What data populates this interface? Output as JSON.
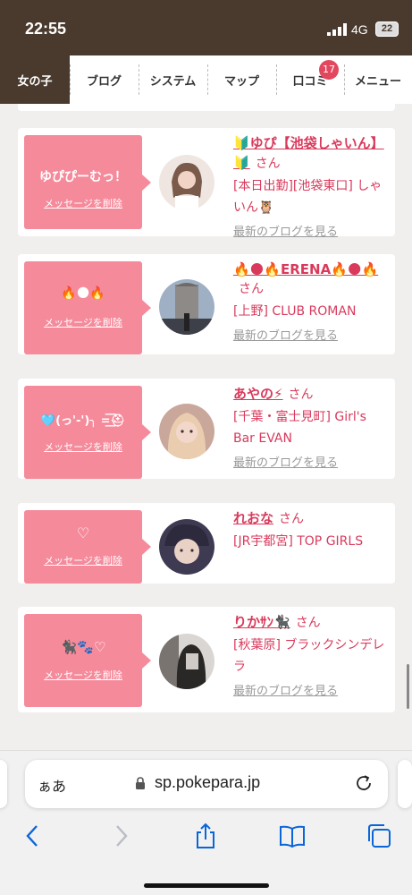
{
  "status": {
    "time": "22:55",
    "network": "4G",
    "battery": "22"
  },
  "nav": {
    "tabs": [
      {
        "label": "女の子",
        "active": true
      },
      {
        "label": "ブログ"
      },
      {
        "label": "システム"
      },
      {
        "label": "マップ"
      },
      {
        "label": "口コミ",
        "badge": "17"
      },
      {
        "label": "メニュー"
      }
    ]
  },
  "messages": [
    {
      "message": "ゆぴぴーむっ！",
      "delete_label": "メッセージを削除",
      "name": "🔰ゆぴ【池袋しゃいん】🔰",
      "san": "さん",
      "shop": "[本日出勤][池袋東口] しゃいん🦉",
      "blog_link": "最新のブログを見る"
    },
    {
      "message": "🔥🌑🔥",
      "delete_label": "メッセージを削除",
      "name": "🔥🌑🔥ERENA🔥🌑🔥",
      "san": "さん",
      "shop": "[上野] CLUB ROMAN",
      "blog_link": "最新のブログを見る"
    },
    {
      "message": "🩵(っ'-')╮ =͟͟͞͞⛑",
      "delete_label": "メッセージを削除",
      "name": "あやの⚡",
      "san": "さん",
      "shop": "[千葉・富士見町] Girl's Bar EVAN",
      "blog_link": "最新のブログを見る"
    },
    {
      "message": "♡",
      "delete_label": "メッセージを削除",
      "name": "れおな",
      "san": "さん",
      "shop": "[JR宇都宮] TOP GIRLS",
      "blog_link": ""
    },
    {
      "message": "🐈‍⬛🐾♡",
      "delete_label": "メッセージを削除",
      "name": "りかｻﾝ🐈‍⬛",
      "san": "さん",
      "shop": "[秋葉原] ブラックシンデレラ",
      "blog_link": "最新のブログを見る"
    }
  ],
  "browser": {
    "aa": "ぁあ",
    "url": "sp.pokepara.jp"
  },
  "colors": {
    "brand_brown": "#4a3a2e",
    "pink": "#f58a9b",
    "link_red": "#d93a5c"
  }
}
